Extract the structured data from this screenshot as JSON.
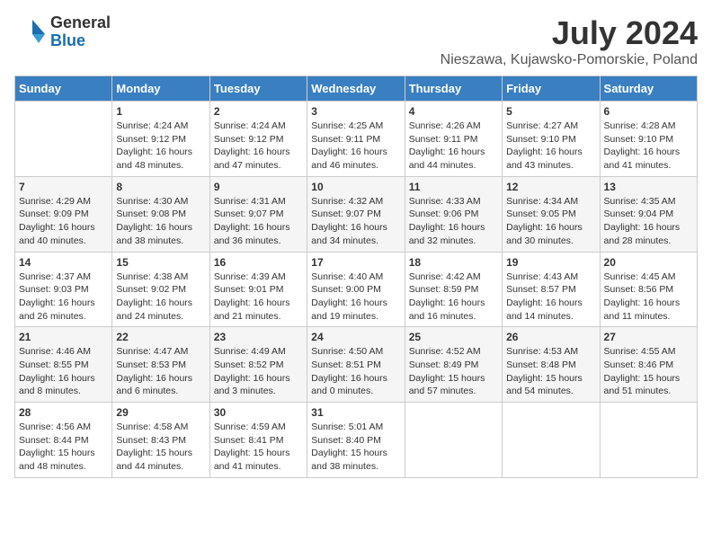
{
  "header": {
    "logo_general": "General",
    "logo_blue": "Blue",
    "title": "July 2024",
    "subtitle": "Nieszawa, Kujawsko-Pomorskie, Poland"
  },
  "days_of_week": [
    "Sunday",
    "Monday",
    "Tuesday",
    "Wednesday",
    "Thursday",
    "Friday",
    "Saturday"
  ],
  "weeks": [
    [
      {
        "day": "",
        "content": ""
      },
      {
        "day": "1",
        "content": "Sunrise: 4:24 AM\nSunset: 9:12 PM\nDaylight: 16 hours\nand 48 minutes."
      },
      {
        "day": "2",
        "content": "Sunrise: 4:24 AM\nSunset: 9:12 PM\nDaylight: 16 hours\nand 47 minutes."
      },
      {
        "day": "3",
        "content": "Sunrise: 4:25 AM\nSunset: 9:11 PM\nDaylight: 16 hours\nand 46 minutes."
      },
      {
        "day": "4",
        "content": "Sunrise: 4:26 AM\nSunset: 9:11 PM\nDaylight: 16 hours\nand 44 minutes."
      },
      {
        "day": "5",
        "content": "Sunrise: 4:27 AM\nSunset: 9:10 PM\nDaylight: 16 hours\nand 43 minutes."
      },
      {
        "day": "6",
        "content": "Sunrise: 4:28 AM\nSunset: 9:10 PM\nDaylight: 16 hours\nand 41 minutes."
      }
    ],
    [
      {
        "day": "7",
        "content": "Sunrise: 4:29 AM\nSunset: 9:09 PM\nDaylight: 16 hours\nand 40 minutes."
      },
      {
        "day": "8",
        "content": "Sunrise: 4:30 AM\nSunset: 9:08 PM\nDaylight: 16 hours\nand 38 minutes."
      },
      {
        "day": "9",
        "content": "Sunrise: 4:31 AM\nSunset: 9:07 PM\nDaylight: 16 hours\nand 36 minutes."
      },
      {
        "day": "10",
        "content": "Sunrise: 4:32 AM\nSunset: 9:07 PM\nDaylight: 16 hours\nand 34 minutes."
      },
      {
        "day": "11",
        "content": "Sunrise: 4:33 AM\nSunset: 9:06 PM\nDaylight: 16 hours\nand 32 minutes."
      },
      {
        "day": "12",
        "content": "Sunrise: 4:34 AM\nSunset: 9:05 PM\nDaylight: 16 hours\nand 30 minutes."
      },
      {
        "day": "13",
        "content": "Sunrise: 4:35 AM\nSunset: 9:04 PM\nDaylight: 16 hours\nand 28 minutes."
      }
    ],
    [
      {
        "day": "14",
        "content": "Sunrise: 4:37 AM\nSunset: 9:03 PM\nDaylight: 16 hours\nand 26 minutes."
      },
      {
        "day": "15",
        "content": "Sunrise: 4:38 AM\nSunset: 9:02 PM\nDaylight: 16 hours\nand 24 minutes."
      },
      {
        "day": "16",
        "content": "Sunrise: 4:39 AM\nSunset: 9:01 PM\nDaylight: 16 hours\nand 21 minutes."
      },
      {
        "day": "17",
        "content": "Sunrise: 4:40 AM\nSunset: 9:00 PM\nDaylight: 16 hours\nand 19 minutes."
      },
      {
        "day": "18",
        "content": "Sunrise: 4:42 AM\nSunset: 8:59 PM\nDaylight: 16 hours\nand 16 minutes."
      },
      {
        "day": "19",
        "content": "Sunrise: 4:43 AM\nSunset: 8:57 PM\nDaylight: 16 hours\nand 14 minutes."
      },
      {
        "day": "20",
        "content": "Sunrise: 4:45 AM\nSunset: 8:56 PM\nDaylight: 16 hours\nand 11 minutes."
      }
    ],
    [
      {
        "day": "21",
        "content": "Sunrise: 4:46 AM\nSunset: 8:55 PM\nDaylight: 16 hours\nand 8 minutes."
      },
      {
        "day": "22",
        "content": "Sunrise: 4:47 AM\nSunset: 8:53 PM\nDaylight: 16 hours\nand 6 minutes."
      },
      {
        "day": "23",
        "content": "Sunrise: 4:49 AM\nSunset: 8:52 PM\nDaylight: 16 hours\nand 3 minutes."
      },
      {
        "day": "24",
        "content": "Sunrise: 4:50 AM\nSunset: 8:51 PM\nDaylight: 16 hours\nand 0 minutes."
      },
      {
        "day": "25",
        "content": "Sunrise: 4:52 AM\nSunset: 8:49 PM\nDaylight: 15 hours\nand 57 minutes."
      },
      {
        "day": "26",
        "content": "Sunrise: 4:53 AM\nSunset: 8:48 PM\nDaylight: 15 hours\nand 54 minutes."
      },
      {
        "day": "27",
        "content": "Sunrise: 4:55 AM\nSunset: 8:46 PM\nDaylight: 15 hours\nand 51 minutes."
      }
    ],
    [
      {
        "day": "28",
        "content": "Sunrise: 4:56 AM\nSunset: 8:44 PM\nDaylight: 15 hours\nand 48 minutes."
      },
      {
        "day": "29",
        "content": "Sunrise: 4:58 AM\nSunset: 8:43 PM\nDaylight: 15 hours\nand 44 minutes."
      },
      {
        "day": "30",
        "content": "Sunrise: 4:59 AM\nSunset: 8:41 PM\nDaylight: 15 hours\nand 41 minutes."
      },
      {
        "day": "31",
        "content": "Sunrise: 5:01 AM\nSunset: 8:40 PM\nDaylight: 15 hours\nand 38 minutes."
      },
      {
        "day": "",
        "content": ""
      },
      {
        "day": "",
        "content": ""
      },
      {
        "day": "",
        "content": ""
      }
    ]
  ]
}
